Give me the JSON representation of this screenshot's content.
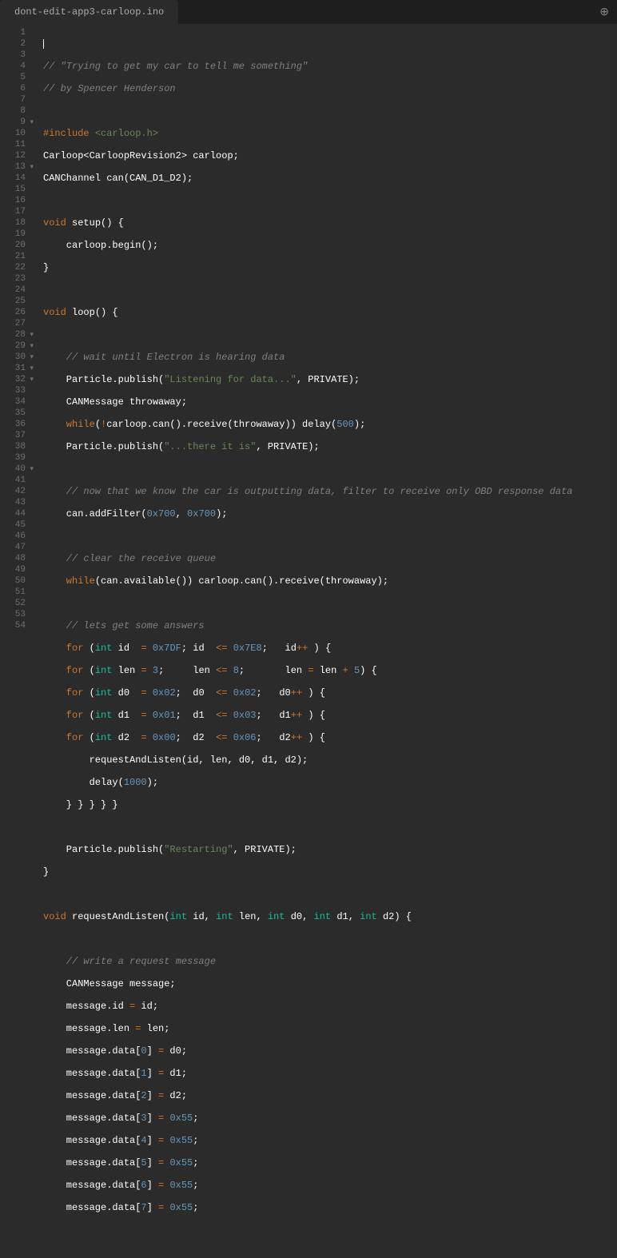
{
  "tab": {
    "title": "dont-edit-app3-carloop.ino"
  },
  "gutter": {
    "start": 1,
    "end": 54,
    "folds": [
      9,
      13,
      28,
      29,
      30,
      31,
      32,
      40
    ]
  },
  "code": {
    "l2": "// \"Trying to get my car to tell me something\"",
    "l3": "// by Spencer Henderson",
    "l5a": "#include",
    "l5b": "<carloop.h>",
    "l6": "Carloop<CarloopRevision2> carloop;",
    "l7": "CANChannel can(CAN_D1_D2);",
    "l9a": "void",
    "l9b": " setup() {",
    "l10": "    carloop.begin();",
    "l11": "}",
    "l13a": "void",
    "l13b": " loop() {",
    "l15": "    // wait until Electron is hearing data",
    "l16a": "    Particle.publish(",
    "l16b": "\"Listening for data...\"",
    "l16c": ", PRIVATE);",
    "l17": "    CANMessage throwaway;",
    "l18a": "    while",
    "l18b": "(",
    "l18c": "!",
    "l18d": "carloop.can().receive(throwaway)) delay(",
    "l18e": "500",
    "l18f": ");",
    "l19a": "    Particle.publish(",
    "l19b": "\"...there it is\"",
    "l19c": ", PRIVATE);",
    "l21": "    // now that we know the car is outputting data, filter to receive only OBD response data",
    "l22a": "    can.addFilter(",
    "l22b": "0x700",
    "l22c": ", ",
    "l22d": "0x700",
    "l22e": ");",
    "l24": "    // clear the receive queue",
    "l25a": "    while",
    "l25b": "(can.available()) carloop.can().receive(throwaway);",
    "l27": "    // lets get some answers",
    "l28a": "    for",
    "l28b": " (",
    "l28c": "int",
    "l28d": " id  ",
    "l28e": "=",
    "l28f": " ",
    "l28g": "0x7DF",
    "l28h": "; id  ",
    "l28i": "<=",
    "l28j": " ",
    "l28k": "0x7E8",
    "l28l": ";   id",
    "l28m": "++",
    "l28n": " ) {",
    "l29a": "    for",
    "l29b": " (",
    "l29c": "int",
    "l29d": " len ",
    "l29e": "=",
    "l29f": " ",
    "l29g": "3",
    "l29h": ";     len ",
    "l29i": "<=",
    "l29j": " ",
    "l29k": "8",
    "l29l": ";       len ",
    "l29m": "=",
    "l29n": " len ",
    "l29o": "+",
    "l29p": " ",
    "l29q": "5",
    "l29r": ") {",
    "l30a": "    for",
    "l30b": " (",
    "l30c": "int",
    "l30d": " d0  ",
    "l30e": "=",
    "l30f": " ",
    "l30g": "0x02",
    "l30h": ";  d0  ",
    "l30i": "<=",
    "l30j": " ",
    "l30k": "0x02",
    "l30l": ";   d0",
    "l30m": "++",
    "l30n": " ) {",
    "l31a": "    for",
    "l31b": " (",
    "l31c": "int",
    "l31d": " d1  ",
    "l31e": "=",
    "l31f": " ",
    "l31g": "0x01",
    "l31h": ";  d1  ",
    "l31i": "<=",
    "l31j": " ",
    "l31k": "0x03",
    "l31l": ";   d1",
    "l31m": "++",
    "l31n": " ) {",
    "l32a": "    for",
    "l32b": " (",
    "l32c": "int",
    "l32d": " d2  ",
    "l32e": "=",
    "l32f": " ",
    "l32g": "0x00",
    "l32h": ";  d2  ",
    "l32i": "<=",
    "l32j": " ",
    "l32k": "0x06",
    "l32l": ";   d2",
    "l32m": "++",
    "l32n": " ) {",
    "l33": "        requestAndListen(id, len, d0, d1, d2);",
    "l34a": "        delay(",
    "l34b": "1000",
    "l34c": ");",
    "l35": "    } } } } }",
    "l37a": "    Particle.publish(",
    "l37b": "\"Restarting\"",
    "l37c": ", PRIVATE);",
    "l38": "}",
    "l40a": "void",
    "l40b": " requestAndListen(",
    "l40c": "int",
    "l40d": " id, ",
    "l40e": "int",
    "l40f": " len, ",
    "l40g": "int",
    "l40h": " d0, ",
    "l40i": "int",
    "l40j": " d1, ",
    "l40k": "int",
    "l40l": " d2) {",
    "l42": "    // write a request message",
    "l43": "    CANMessage message;",
    "l44a": "    message.id ",
    "l44b": "=",
    "l44c": " id;",
    "l45a": "    message.len ",
    "l45b": "=",
    "l45c": " len;",
    "l46a": "    message.data[",
    "l46b": "0",
    "l46c": "] ",
    "l46d": "=",
    "l46e": " d0;",
    "l47a": "    message.data[",
    "l47b": "1",
    "l47c": "] ",
    "l47d": "=",
    "l47e": " d1;",
    "l48a": "    message.data[",
    "l48b": "2",
    "l48c": "] ",
    "l48d": "=",
    "l48e": " d2;",
    "l49a": "    message.data[",
    "l49b": "3",
    "l49c": "] ",
    "l49d": "=",
    "l49e": " ",
    "l49f": "0x55",
    "l49g": ";",
    "l50a": "    message.data[",
    "l50b": "4",
    "l50c": "] ",
    "l50d": "=",
    "l50e": " ",
    "l50f": "0x55",
    "l50g": ";",
    "l51a": "    message.data[",
    "l51b": "5",
    "l51c": "] ",
    "l51d": "=",
    "l51e": " ",
    "l51f": "0x55",
    "l51g": ";",
    "l52a": "    message.data[",
    "l52b": "6",
    "l52c": "] ",
    "l52d": "=",
    "l52e": " ",
    "l52f": "0x55",
    "l52g": ";",
    "l53a": "    message.data[",
    "l53b": "7",
    "l53c": "] ",
    "l53d": "=",
    "l53e": " ",
    "l53f": "0x55",
    "l53g": ";"
  }
}
